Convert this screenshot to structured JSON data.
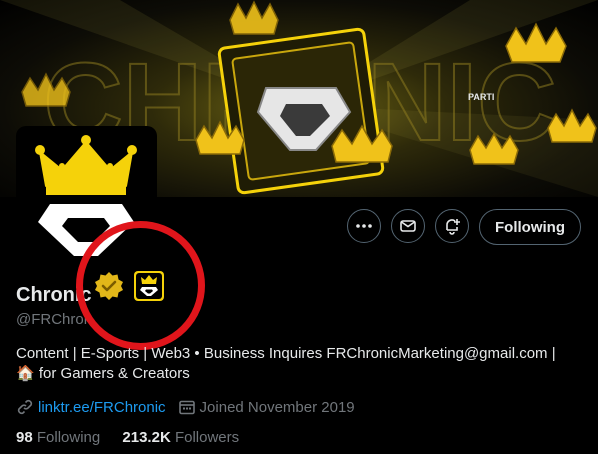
{
  "profile": {
    "name": "Chronic",
    "handle": "@FRChron",
    "bio_line1": "Content | E-Sports | Web3 • Business Inquires FRChronicMarketing@gmail.com |",
    "bio_line2_emoji": "🏠",
    "bio_line2_text": "for Gamers & Creators",
    "link": "linktr.ee/FRChronic",
    "joined": "Joined November 2019",
    "following_count": "98",
    "following_label": "Following",
    "followers_count": "213.2K",
    "followers_label": "Followers"
  },
  "actions": {
    "more_label": "More",
    "message_label": "Message",
    "notify_label": "Turn on notifications",
    "following_button": "Following"
  },
  "banner": {
    "watermark_text": "CHRONIC",
    "partner_tag": "PARTI"
  },
  "colors": {
    "accent_link": "#1d9bf0",
    "verified_gold": "#e2b719",
    "crown_yellow": "#f5d20a",
    "annotation_red": "#e0151b"
  },
  "icons": [
    "more-icon",
    "mail-icon",
    "bell-plus-icon",
    "verified-badge-icon",
    "affiliate-badge-icon",
    "link-icon",
    "calendar-icon",
    "crown-icon"
  ]
}
